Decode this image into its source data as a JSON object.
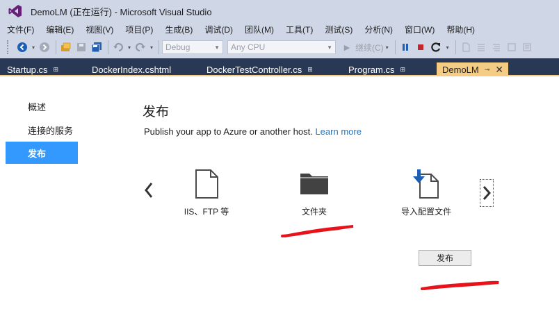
{
  "window": {
    "title": "DemoLM (正在运行) - Microsoft Visual Studio"
  },
  "menu": {
    "items": [
      {
        "label": "文件(F)"
      },
      {
        "label": "编辑(E)"
      },
      {
        "label": "视图(V)"
      },
      {
        "label": "项目(P)"
      },
      {
        "label": "生成(B)"
      },
      {
        "label": "调试(D)"
      },
      {
        "label": "团队(M)"
      },
      {
        "label": "工具(T)"
      },
      {
        "label": "测试(S)"
      },
      {
        "label": "分析(N)"
      },
      {
        "label": "窗口(W)"
      },
      {
        "label": "帮助(H)"
      }
    ]
  },
  "toolbar": {
    "config": "Debug",
    "platform": "Any CPU",
    "continue_label": "继续(C)"
  },
  "tabs": [
    {
      "label": "Startup.cs",
      "pin": "⊞"
    },
    {
      "label": "DockerIndex.cshtml"
    },
    {
      "label": "DockerTestController.cs",
      "pin": "⊞"
    },
    {
      "label": "Program.cs",
      "pin": "⊞"
    },
    {
      "label": "DemoLM",
      "pin": "⊸",
      "close": "✕"
    }
  ],
  "sidebar": {
    "items": [
      {
        "label": "概述"
      },
      {
        "label": "连接的服务"
      },
      {
        "label": "发布"
      }
    ]
  },
  "page": {
    "title": "发布",
    "subtitle": "Publish your app to Azure or another host.",
    "learn_more": "Learn more"
  },
  "targets": [
    {
      "label": "IIS、FTP 等",
      "icon": "document-icon"
    },
    {
      "label": "文件夹",
      "icon": "folder-icon"
    },
    {
      "label": "导入配置文件",
      "icon": "import-profile-icon"
    }
  ],
  "publish_button": "发布",
  "colors": {
    "chrome": "#cfd6e5",
    "tab_bar": "#293955",
    "active_tab": "#f5cc84",
    "sidebar_active": "#3399ff",
    "link": "#1e76c7",
    "annotation_red": "#e8121b"
  }
}
